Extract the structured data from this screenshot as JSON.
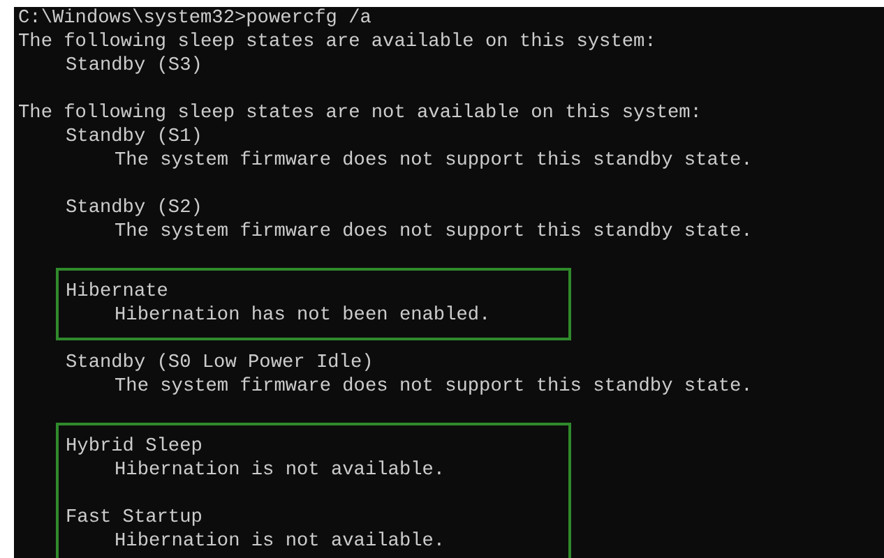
{
  "prompt": "C:\\Windows\\system32>powercfg /a",
  "sections": [
    {
      "heading": "The following sleep states are available on this system:",
      "groups": [
        {
          "highlighted": false,
          "states": [
            {
              "name": "Standby (S3)"
            }
          ]
        }
      ]
    },
    {
      "heading": "The following sleep states are not available on this system:",
      "groups": [
        {
          "highlighted": false,
          "states": [
            {
              "name": "Standby (S1)",
              "reason": "The system firmware does not support this standby state."
            }
          ]
        },
        {
          "highlighted": false,
          "states": [
            {
              "name": "Standby (S2)",
              "reason": "The system firmware does not support this standby state."
            }
          ]
        },
        {
          "highlighted": true,
          "states": [
            {
              "name": "Hibernate",
              "reason": "Hibernation has not been enabled."
            }
          ]
        },
        {
          "highlighted": false,
          "states": [
            {
              "name": "Standby (S0 Low Power Idle)",
              "reason": "The system firmware does not support this standby state."
            }
          ]
        },
        {
          "highlighted": true,
          "states": [
            {
              "name": "Hybrid Sleep",
              "reason": "Hibernation is not available."
            },
            {
              "name": "Fast Startup",
              "reason": "Hibernation is not available."
            }
          ]
        }
      ]
    }
  ]
}
